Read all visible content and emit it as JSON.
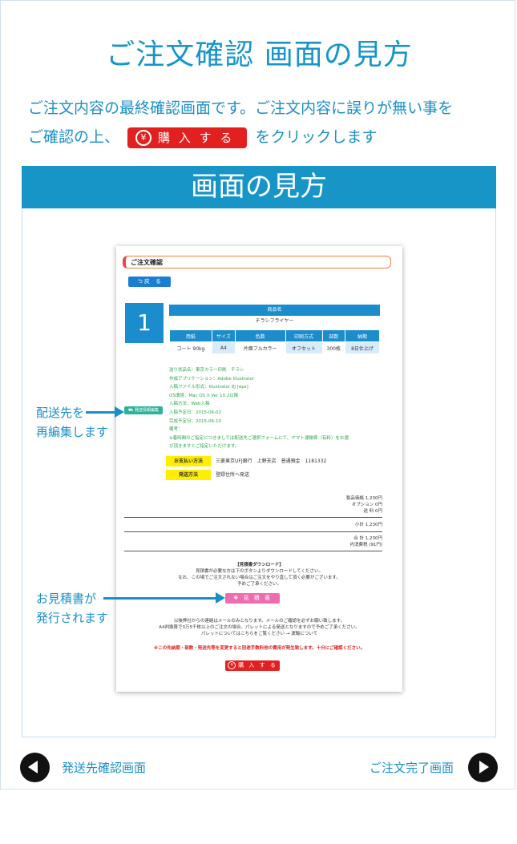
{
  "page": {
    "title": "ご注文確認 画面の見方",
    "intro_line1": "ご注文内容の最終確認画面です。ご注文内容に誤りが無い事を",
    "intro_line2_pre": "ご確認の上、",
    "intro_button_label": "購 入 す る",
    "intro_button_icon": "¥",
    "intro_line2_post": "をクリックします",
    "section_heading": "画面の見方"
  },
  "screenshot": {
    "title": "ご注文確認",
    "back_label": "戻　る",
    "item_number": "1",
    "product_header": "商品名",
    "product_name": "チラシフライヤー",
    "spec_headers": [
      "用紙",
      "サイズ",
      "色数",
      "印刷方式",
      "部数",
      "納期"
    ],
    "spec_values": [
      "コート 90kg",
      "A4",
      "片面フルカラー",
      "オフセット",
      "300枚",
      "8日仕上げ"
    ],
    "info_lines": [
      "送り状品名：東京カラー印刷　チラシ",
      "作成アプリケーション：Adobe Illustrator",
      "入稿ファイル形式：Illustrator 8J [eps]",
      "OS環境：Mac OS X Ver 10.2以降",
      "入稿方法：Web入稿",
      "入稿予定日：2015-06-02",
      "完成予定日：2015-06-10",
      "備考：",
      "※着時間のご指定につきましては配送先ご選択フォームにて、ヤマト運輸様（有料）をお選",
      "び頂きますとご指定いただけます。"
    ],
    "edit_chip_label": "発送情報編集",
    "payment_label": "お支払い方法",
    "payment_value": "三菱東京UFJ銀行　上野支店　普通預金　1181332",
    "shipping_label": "発送方法",
    "shipping_value": "登録住所へ発送",
    "price_lines": [
      "製品価格 1,230円",
      "オプション 0円",
      "送 料 0円"
    ],
    "subtotal": "小計 1,230円",
    "total": "合 計 1,230円",
    "tax": "内消費税 (91円)",
    "download_lines": [
      "【見積書ダウンロード】",
      "見積書が必要な方は下のボタンよりダウンロードしてください。",
      "なお、この場でご注文されない場合はご注文をやり直して頂く必要がございます。",
      "予めご了承ください。"
    ],
    "estimate_button": "見 積 書",
    "notice_lines": [
      "以後弊社からの連絡はメールのみとなります。メールのご確認を必ずお願い致します。",
      "A4判換算で3万5千枚以上のご注文の場合、パレットによる発送となりますので予めご了承ください。",
      "パレットについてはこちらをご覧ください → 運輸について"
    ],
    "red_notice": "※この先納期・部数・発送先等を変更すると別途手数料他の費用が発生致します。十分にご確認ください。",
    "buy_button": "購 入 す る",
    "buy_icon": "¥"
  },
  "annotations": {
    "edit_line1": "配送先を",
    "edit_line2": "再編集します",
    "estimate_line1": "お見積書が",
    "estimate_line2": "発行されます"
  },
  "nav": {
    "prev_label": "発送先確認画面",
    "next_label": "ご注文完了画面"
  },
  "colors": {
    "accent": "#1895c7",
    "buy_red": "#e32020",
    "estimate_pink": "#f06cb0",
    "info_green": "#2aa84a",
    "highlight_yellow": "#ffee00"
  }
}
